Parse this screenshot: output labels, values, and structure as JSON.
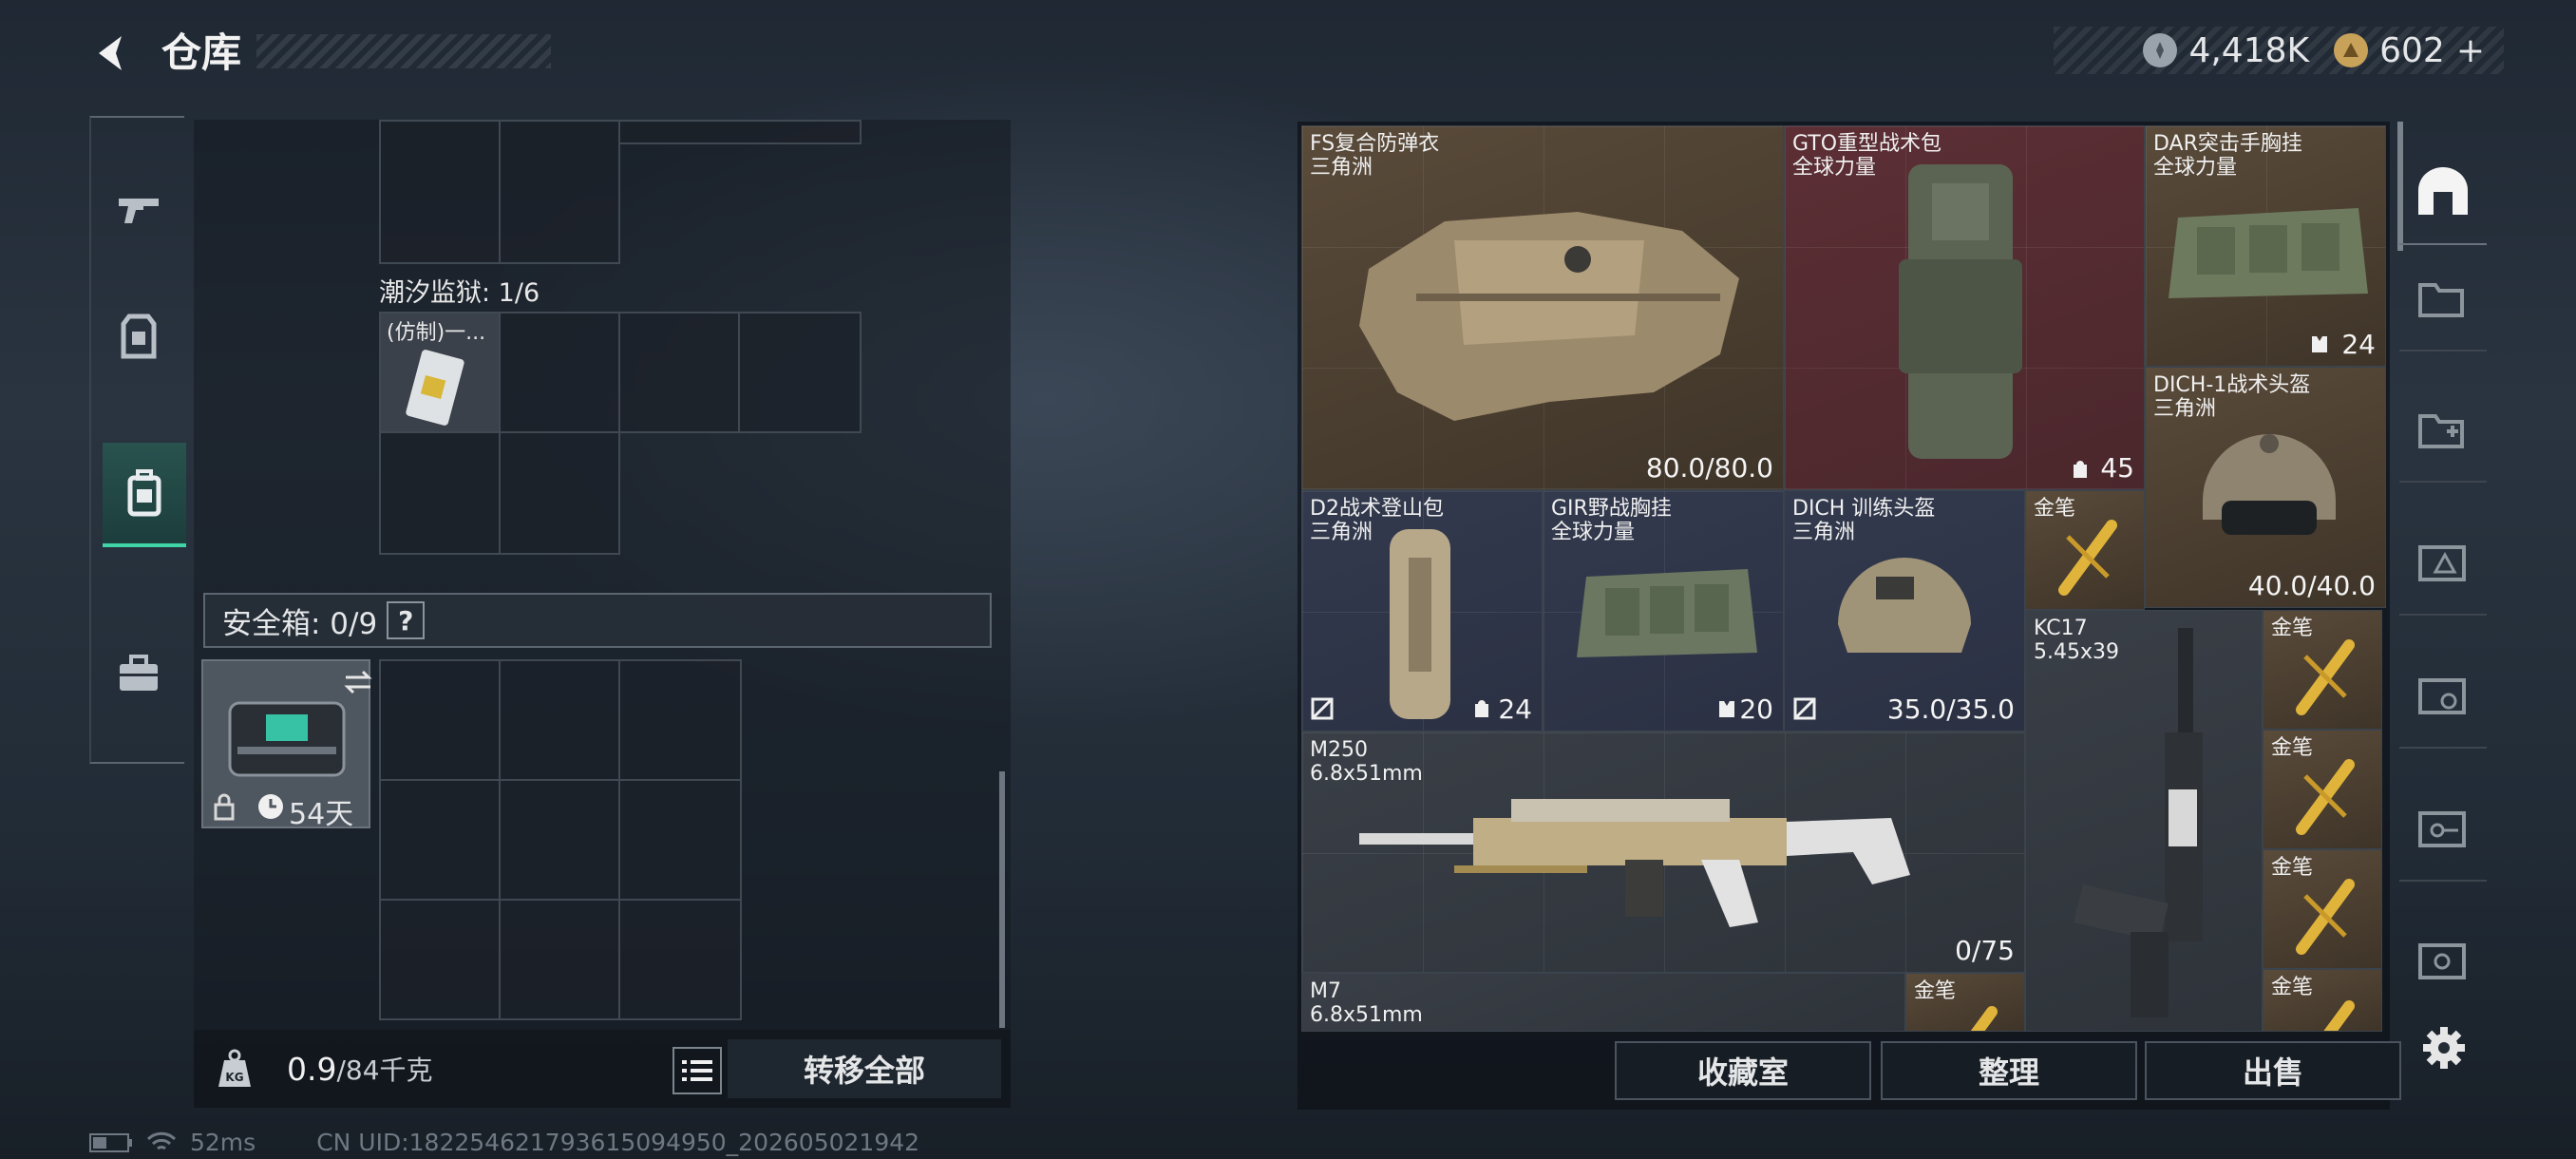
{
  "header": {
    "title": "仓库"
  },
  "currency": {
    "silver": "4,418K",
    "gold": "602",
    "plus": "+"
  },
  "nav": [
    {
      "name": "weapons"
    },
    {
      "name": "equipment"
    },
    {
      "name": "backpack"
    },
    {
      "name": "case"
    }
  ],
  "left": {
    "prison_label": "潮汐监狱: 1/6",
    "prison_item": "(仿制)一...",
    "safe_label": "安全箱: 0/9",
    "help": "?",
    "safe_days": "54天",
    "weight_value": "0.9",
    "weight_max": "/84千克",
    "transfer_all": "转移全部"
  },
  "status": {
    "ping": "52ms",
    "uid": "CN UID:182254621793615094950_202605021942"
  },
  "items": {
    "fs": {
      "name": "FS复合防弹衣\n三角洲",
      "value": "80.0/80.0"
    },
    "gto": {
      "name": "GTO重型战术包\n全球力量",
      "value": "45"
    },
    "dar": {
      "name": "DAR突击手胸挂\n全球力量",
      "value": "24"
    },
    "dich1": {
      "name": "DICH-1战术头盔\n三角洲",
      "value": "40.0/40.0"
    },
    "d2": {
      "name": "D2战术登山包\n三角洲",
      "value": "24"
    },
    "gir": {
      "name": "GIR野战胸挂\n全球力量",
      "value": "20"
    },
    "dicht": {
      "name": "DICH 训练头盔\n三角洲",
      "value": "35.0/35.0"
    },
    "pen1": {
      "name": "金笔"
    },
    "kc17": {
      "name": "KC17\n5.45x39"
    },
    "pen2": {
      "name": "金笔"
    },
    "m250": {
      "name": "M250\n6.8x51mm",
      "value": "0/75"
    },
    "pen3": {
      "name": "金笔"
    },
    "pen4": {
      "name": "金笔"
    },
    "m7": {
      "name": "M7\n6.8x51mm"
    },
    "pen5": {
      "name": "金笔"
    },
    "pen6": {
      "name": "金笔"
    }
  },
  "actions": {
    "collection": "收藏室",
    "organize": "整理",
    "sell": "出售"
  }
}
